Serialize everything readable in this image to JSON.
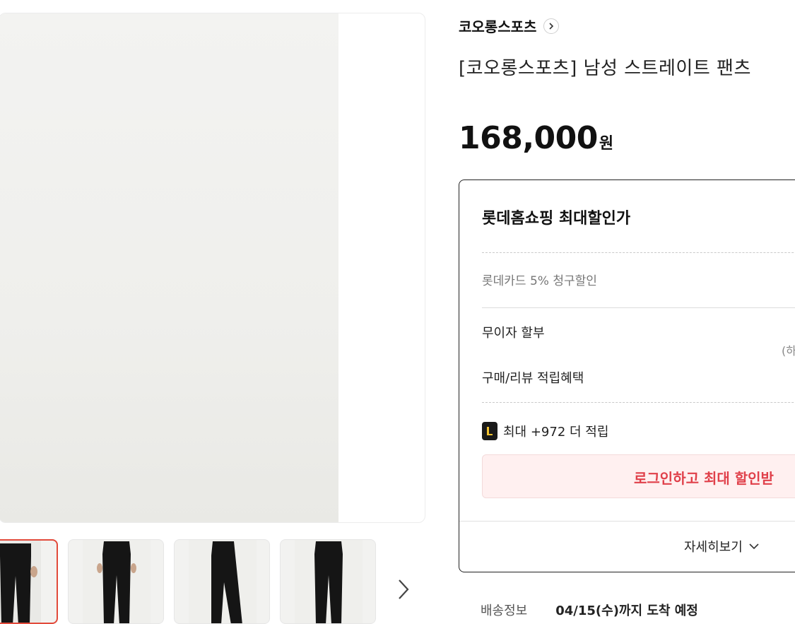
{
  "brand": {
    "name": "코오롱스포츠"
  },
  "product": {
    "title": "[코오롱스포츠] 남성 스트레이트 팬츠",
    "price": "168,000",
    "currency_unit": "원"
  },
  "benefits": {
    "title": "롯데홈쇼핑 최대할인가",
    "card_discount": "롯데카드 5% 청구할인",
    "installment": "무이자 할부",
    "installment_note": "(하",
    "points_label": "구매/리뷰 적립혜택",
    "points_extra": "최대 +972 더 적립",
    "login_button": "로그인하고 최대 할인받",
    "more_button": "자세히보기"
  },
  "shipping": {
    "label": "배송정보",
    "value": "04/15(수)까지 도착 예정"
  },
  "colors": {
    "accent_red": "#e0404a",
    "thumb_active_border": "#e24a3b",
    "login_bg": "#fff0f0"
  },
  "icons": [
    "chevron-right-icon",
    "chevron-down-icon",
    "l-point-icon"
  ]
}
